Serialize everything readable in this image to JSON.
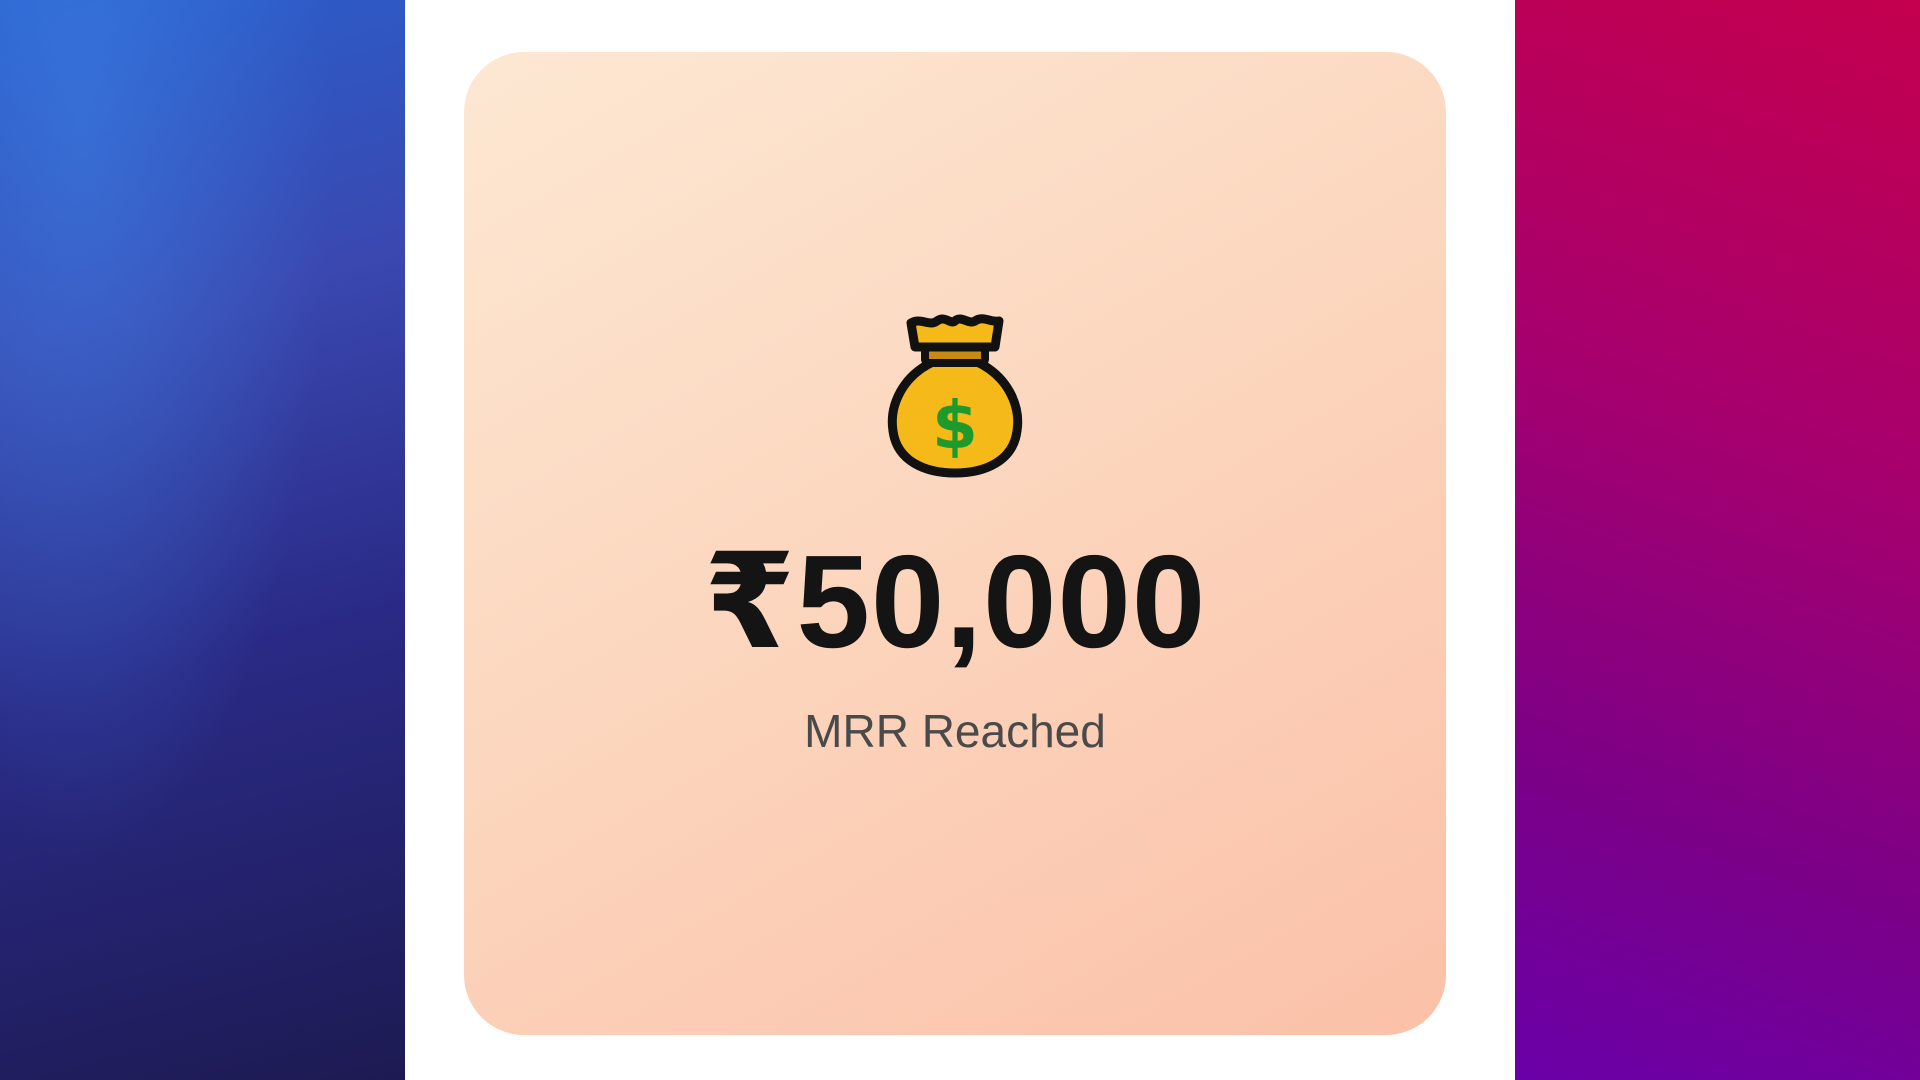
{
  "milestone": {
    "icon": "money-bag-icon",
    "amount": "₹50,000",
    "label": "MRR Reached"
  },
  "colors": {
    "card_start": "#fde8d3",
    "card_end": "#fbc0a8",
    "left_panel": "#2a3fa8",
    "right_panel": "#a0006e",
    "amount_text": "#141414",
    "label_text": "#4a4a4a"
  }
}
